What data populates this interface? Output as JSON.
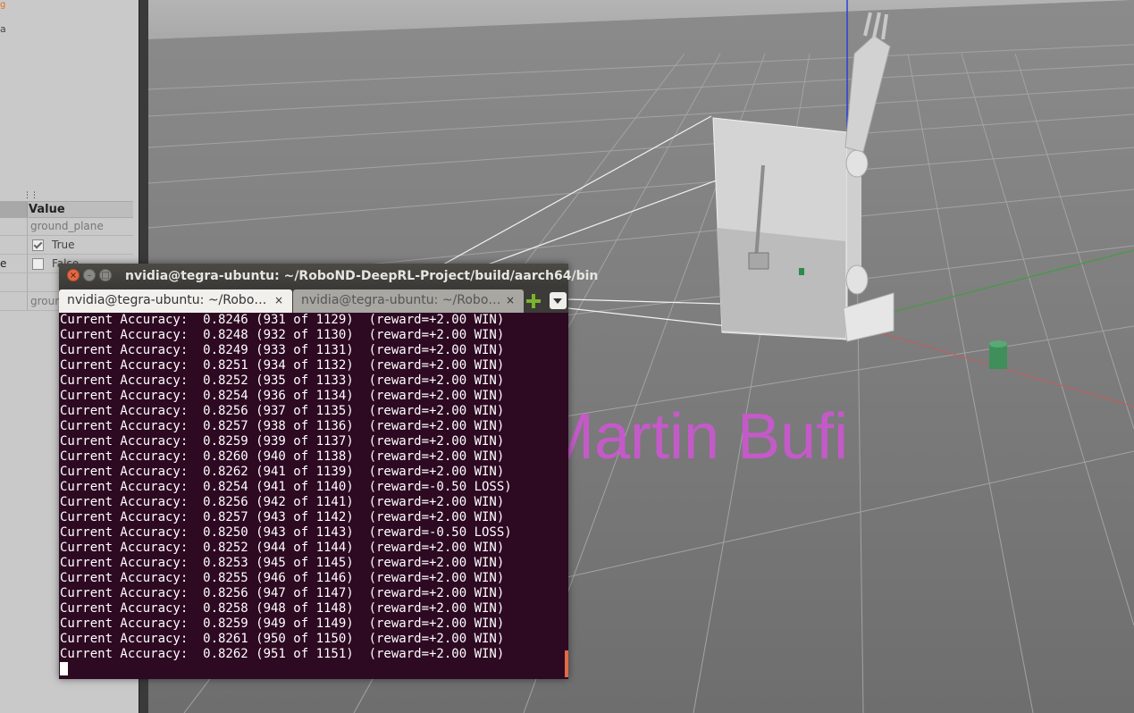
{
  "left_panel": {
    "top_label": "a",
    "orange_mark": "g",
    "header": {
      "value_label": "Value"
    },
    "rows": [
      {
        "key": "",
        "value": "ground_plane"
      },
      {
        "key": "",
        "checked": true,
        "check_label": "True"
      },
      {
        "key": "e",
        "checked": false,
        "check_label": "False"
      },
      {
        "key": "",
        "value": ""
      },
      {
        "key": "",
        "value": "groun"
      }
    ]
  },
  "watermark": "Martin Bufi",
  "terminal": {
    "title": "nvidia@tegra-ubuntu: ~/RoboND-DeepRL-Project/build/aarch64/bin",
    "tabs": [
      {
        "label": "nvidia@tegra-ubuntu: ~/Robo…",
        "active": true
      },
      {
        "label": "nvidia@tegra-ubuntu: ~/Robo…",
        "active": false
      }
    ],
    "close_glyph": "×",
    "lines": [
      "Current Accuracy:  0.8246 (931 of 1129)  (reward=+2.00 WIN)",
      "Current Accuracy:  0.8248 (932 of 1130)  (reward=+2.00 WIN)",
      "Current Accuracy:  0.8249 (933 of 1131)  (reward=+2.00 WIN)",
      "Current Accuracy:  0.8251 (934 of 1132)  (reward=+2.00 WIN)",
      "Current Accuracy:  0.8252 (935 of 1133)  (reward=+2.00 WIN)",
      "Current Accuracy:  0.8254 (936 of 1134)  (reward=+2.00 WIN)",
      "Current Accuracy:  0.8256 (937 of 1135)  (reward=+2.00 WIN)",
      "Current Accuracy:  0.8257 (938 of 1136)  (reward=+2.00 WIN)",
      "Current Accuracy:  0.8259 (939 of 1137)  (reward=+2.00 WIN)",
      "Current Accuracy:  0.8260 (940 of 1138)  (reward=+2.00 WIN)",
      "Current Accuracy:  0.8262 (941 of 1139)  (reward=+2.00 WIN)",
      "Current Accuracy:  0.8254 (941 of 1140)  (reward=-0.50 LOSS)",
      "Current Accuracy:  0.8256 (942 of 1141)  (reward=+2.00 WIN)",
      "Current Accuracy:  0.8257 (943 of 1142)  (reward=+2.00 WIN)",
      "Current Accuracy:  0.8250 (943 of 1143)  (reward=-0.50 LOSS)",
      "Current Accuracy:  0.8252 (944 of 1144)  (reward=+2.00 WIN)",
      "Current Accuracy:  0.8253 (945 of 1145)  (reward=+2.00 WIN)",
      "Current Accuracy:  0.8255 (946 of 1146)  (reward=+2.00 WIN)",
      "Current Accuracy:  0.8256 (947 of 1147)  (reward=+2.00 WIN)",
      "Current Accuracy:  0.8258 (948 of 1148)  (reward=+2.00 WIN)",
      "Current Accuracy:  0.8259 (949 of 1149)  (reward=+2.00 WIN)",
      "Current Accuracy:  0.8261 (950 of 1150)  (reward=+2.00 WIN)",
      "Current Accuracy:  0.8262 (951 of 1151)  (reward=+2.00 WIN)"
    ]
  },
  "colors": {
    "terminal_bg": "#2d0922",
    "watermark": "#c45ac8",
    "close_button": "#e06a44",
    "new_tab_plus": "#7bb32e"
  },
  "icons": {
    "close": "close-icon",
    "minimize": "minimize-icon",
    "maximize": "maximize-icon",
    "new_tab": "plus-icon",
    "tab_menu": "chevron-down-icon"
  }
}
